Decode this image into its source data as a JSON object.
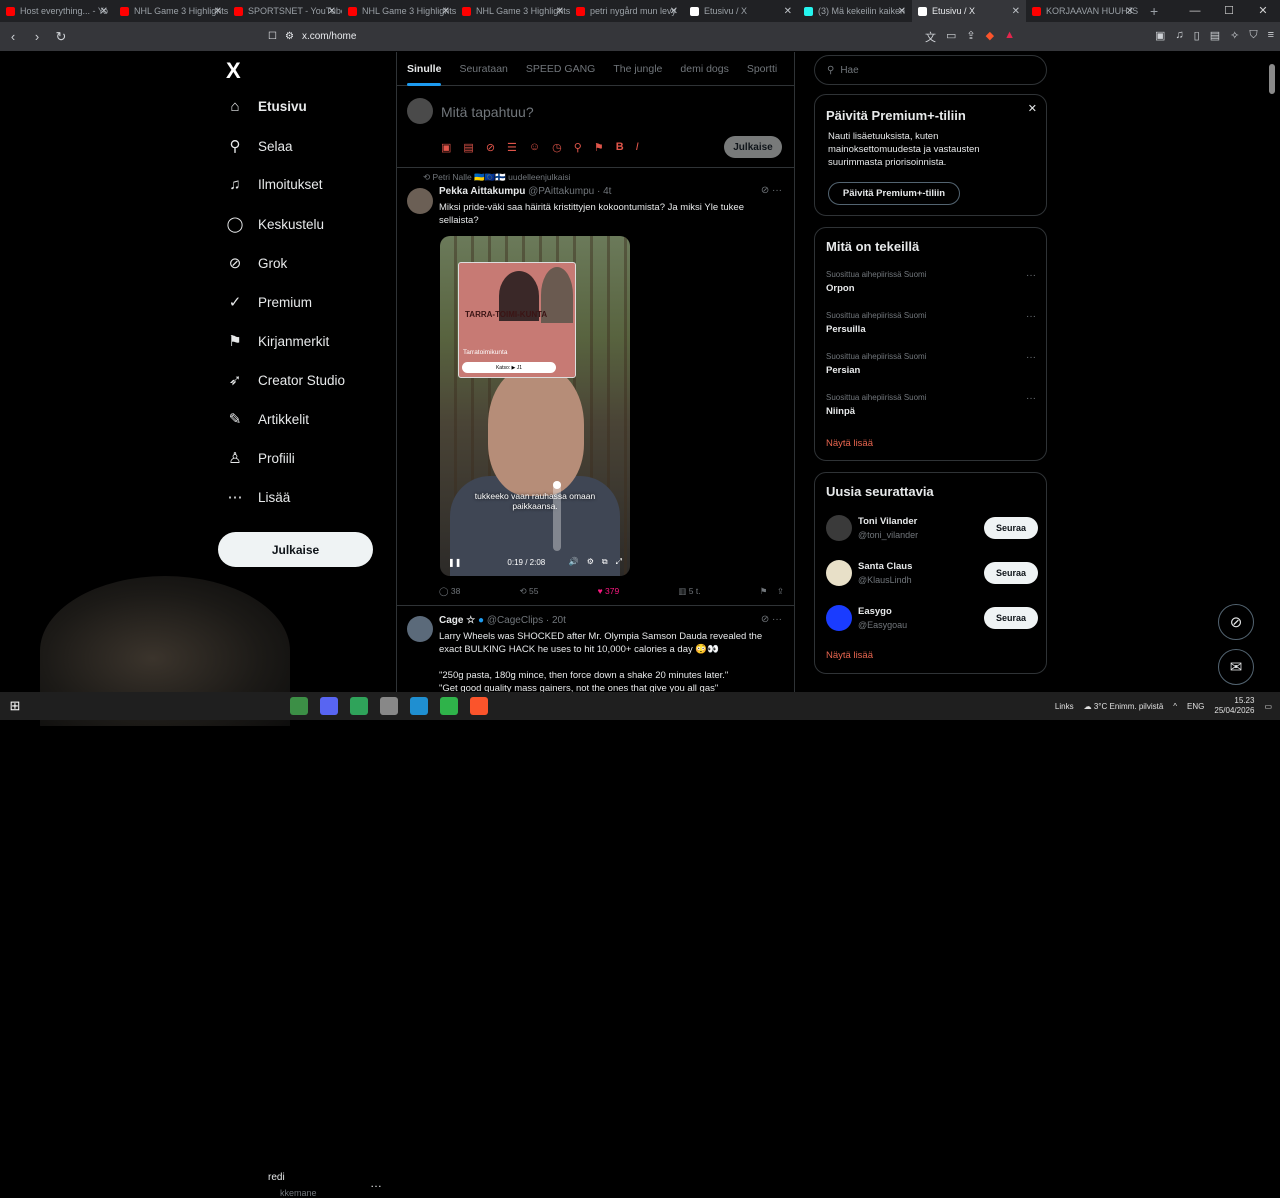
{
  "browser": {
    "tabs": [
      {
        "title": "Host everything... - Yo",
        "color": "#ff0000"
      },
      {
        "title": "NHL Game 3 Highlights",
        "color": "#ff0000"
      },
      {
        "title": "SPORTSNET - YouTube",
        "color": "#ff0000"
      },
      {
        "title": "NHL Game 3 Highlights",
        "color": "#ff0000"
      },
      {
        "title": "NHL Game 3 Highlights",
        "color": "#ff0000"
      },
      {
        "title": "petri nygård mun levy",
        "color": "#ff0000"
      },
      {
        "title": "Etusivu / X",
        "color": "#ffffff"
      },
      {
        "title": "(3) Mä kekeilin kaiken",
        "color": "#25f4ee"
      },
      {
        "title": "Etusivu / X",
        "color": "#ffffff"
      },
      {
        "title": "KORJAAVAN HUUHJS",
        "color": "#ff0000"
      }
    ],
    "new_tab": "+",
    "url": "x.com/home"
  },
  "sidebar": {
    "logo": "X",
    "items": [
      {
        "label": "Etusivu",
        "icon": "home-icon",
        "glyph": "⌂"
      },
      {
        "label": "Selaa",
        "icon": "search-icon",
        "glyph": "⚲"
      },
      {
        "label": "Ilmoitukset",
        "icon": "bell-icon",
        "glyph": "♫"
      },
      {
        "label": "Keskustelu",
        "icon": "chat-icon",
        "glyph": "◯"
      },
      {
        "label": "Grok",
        "icon": "grok-icon",
        "glyph": "⊘"
      },
      {
        "label": "Premium",
        "icon": "premium-icon",
        "glyph": "✓"
      },
      {
        "label": "Kirjanmerkit",
        "icon": "bookmark-icon",
        "glyph": "⚑"
      },
      {
        "label": "Creator Studio",
        "icon": "rocket-icon",
        "glyph": "➶"
      },
      {
        "label": "Artikkelit",
        "icon": "article-icon",
        "glyph": "✎"
      },
      {
        "label": "Profiili",
        "icon": "profile-icon",
        "glyph": "♙"
      },
      {
        "label": "Lisää",
        "icon": "more-icon",
        "glyph": "⋯"
      }
    ],
    "post_button": "Julkaise",
    "account_name": "redi",
    "account_handle": "kkemane",
    "account_more": "…"
  },
  "feed": {
    "tabs": [
      "Sinulle",
      "Seurataan",
      "SPEED GANG",
      "The jungle",
      "demi dogs",
      "Sportti"
    ],
    "compose_placeholder": "Mitä tapahtuu?",
    "compose_post": "Julkaise",
    "tweet1": {
      "repost_line": "Petri Nalle 🇺🇦🇪🇺🇫🇮 uudelleenjulkaisi",
      "name": "Pekka Aittakumpu",
      "handle": "@PAittakumpu · 4t",
      "text": "Miksi pride-väki saa häiritä kristittyjen kokoontumista? Ja miksi Yle tukee sellaista?",
      "video": {
        "inset_title": "TARRA-TOIMI-KUNTA",
        "inset_caption": "Tarratoimikunta",
        "inset_watch": "Katso: ▶ J1",
        "subtitle": "tukkeeko vaan rauhassa omaan paikkaansa.",
        "time": "0:19 / 2:08",
        "volume": 1.0
      },
      "stats": {
        "replies": "38",
        "reposts": "55",
        "likes": "379",
        "views": "5 t."
      }
    },
    "tweet2": {
      "name": "Cage ☆",
      "handle": "@CageClips · 20t",
      "text1": "Larry Wheels was SHOCKED after Mr. Olympia Samson Dauda revealed the exact BULKING HACK he uses to hit 10,000+ calories a day 😳👀",
      "text2": "\"250g pasta, 180g mince, then force down a shake 20 minutes later.\"",
      "text3": "\"Get good quality mass gainers, not the ones that give you all gas\""
    }
  },
  "right": {
    "search_placeholder": "Hae",
    "premium": {
      "title": "Päivitä Premium+-tiliin",
      "text": "Nauti lisäetuuksista, kuten mainoksettomuudesta ja vastausten suurimmasta priorisoinnista.",
      "button": "Päivitä Premium+-tiliin"
    },
    "trends": {
      "title": "Mitä on tekeillä",
      "items": [
        {
          "context": "Suosittua aihepiirissä Suomi",
          "topic": "Orpon"
        },
        {
          "context": "Suosittua aihepiirissä Suomi",
          "topic": "Persuilla"
        },
        {
          "context": "Suosittua aihepiirissä Suomi",
          "topic": "Persian"
        },
        {
          "context": "Suosittua aihepiirissä Suomi",
          "topic": "Niinpä"
        }
      ],
      "more": "Näytä lisää"
    },
    "who_to_follow": {
      "title": "Uusia seurattavia",
      "items": [
        {
          "name": "Toni Vilander",
          "handle": "@toni_vilander",
          "button": "Seuraa",
          "color": "#3a3a3a"
        },
        {
          "name": "Santa Claus",
          "handle": "@KlausLindh",
          "button": "Seuraa",
          "color": "#e8e0c8"
        },
        {
          "name": "Easygo",
          "handle": "@Easygoau",
          "button": "Seuraa",
          "color": "#1a3cff"
        }
      ],
      "more": "Näytä lisää"
    }
  },
  "taskbar": {
    "links": "Links",
    "weather": "3°C  Enimm. pilvistä",
    "lang": "ENG",
    "time": "15.23",
    "date": "25/04/2026"
  }
}
